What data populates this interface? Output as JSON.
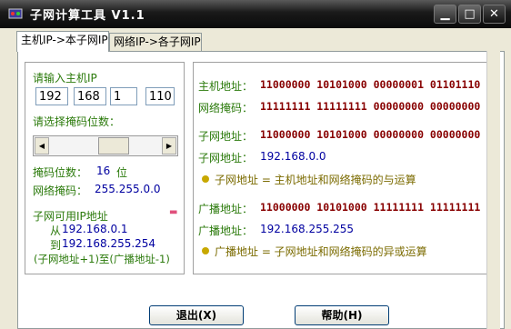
{
  "window": {
    "title": "子网计算工具 V1.1"
  },
  "tabs": [
    {
      "label": "主机IP->本子网IP"
    },
    {
      "label": "网络IP->各子网IP"
    }
  ],
  "left": {
    "ip_prompt": "请输入主机IP",
    "ip": [
      "192",
      "168",
      "1",
      "110"
    ],
    "mask_prompt": "请选择掩码位数：",
    "slider_value": 0.5,
    "mask_bits_label": "掩码位数：",
    "mask_bits_value": "16",
    "mask_bits_unit": "位",
    "netmask_label": "网络掩码：",
    "netmask_value": "255.255.0.0",
    "usable_title": "子网可用IP地址",
    "from_label": "从",
    "from_value": "192.168.0.1",
    "to_label": "到",
    "to_value": "192.168.255.254",
    "range_note": "(子网地址+1)至(广播地址-1)"
  },
  "right": {
    "host_label": "主机地址：",
    "host_bits": "11000000  10101000  00000001  01101110",
    "mask_label": "网络掩码：",
    "mask_bits": "11111111  11111111  00000000  00000000",
    "subnet_label": "子网地址：",
    "subnet_bits": "11000000  10101000  00000000  00000000",
    "subnet_addr_label": "子网地址：",
    "subnet_addr": "192.168.0.0",
    "subnet_note": "子网地址 = 主机地址和网络掩码的与运算",
    "bcast_label": "广播地址：",
    "bcast_bits": "11000000  10101000  11111111  11111111",
    "bcast_addr_label": "广播地址：",
    "bcast_addr": "192.168.255.255",
    "bcast_note": "广播地址 = 子网地址和网络掩码的异或运算"
  },
  "buttons": {
    "exit": "退出(X)",
    "help": "帮助(H)"
  },
  "colors": {
    "green": "#2b7a0b",
    "blue": "#0000a0",
    "dark_red": "#880000",
    "olive": "#7b6b00"
  }
}
